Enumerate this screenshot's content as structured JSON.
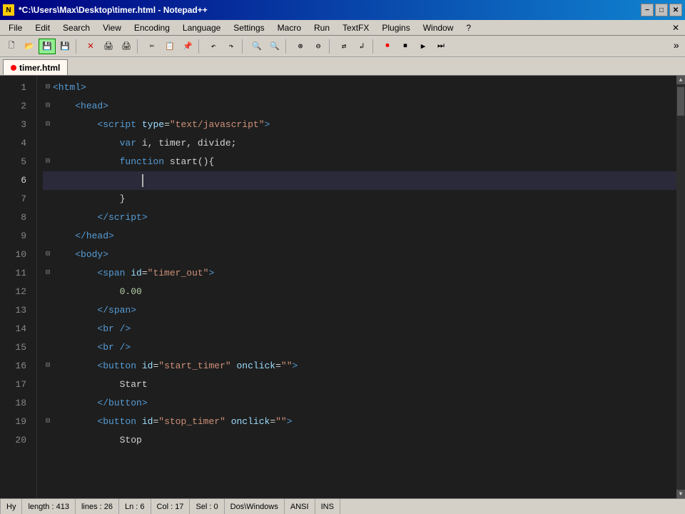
{
  "titleBar": {
    "title": "*C:\\Users\\Max\\Desktop\\timer.html - Notepad++",
    "icon": "N",
    "minimize": "−",
    "maximize": "□",
    "close": "✕"
  },
  "menuBar": {
    "items": [
      "File",
      "Edit",
      "Search",
      "View",
      "Encoding",
      "Language",
      "Settings",
      "Macro",
      "Run",
      "TextFX",
      "Plugins",
      "Window",
      "?"
    ],
    "closeBtn": "✕"
  },
  "tab": {
    "filename": "timer.html"
  },
  "statusBar": {
    "hint": "Hy",
    "length": "length : 413",
    "lines": "lines : 26",
    "ln": "Ln : 6",
    "col": "Col : 17",
    "sel": "Sel : 0",
    "lineEnding": "Dos\\Windows",
    "encoding": "ANSI",
    "mode": "INS"
  }
}
